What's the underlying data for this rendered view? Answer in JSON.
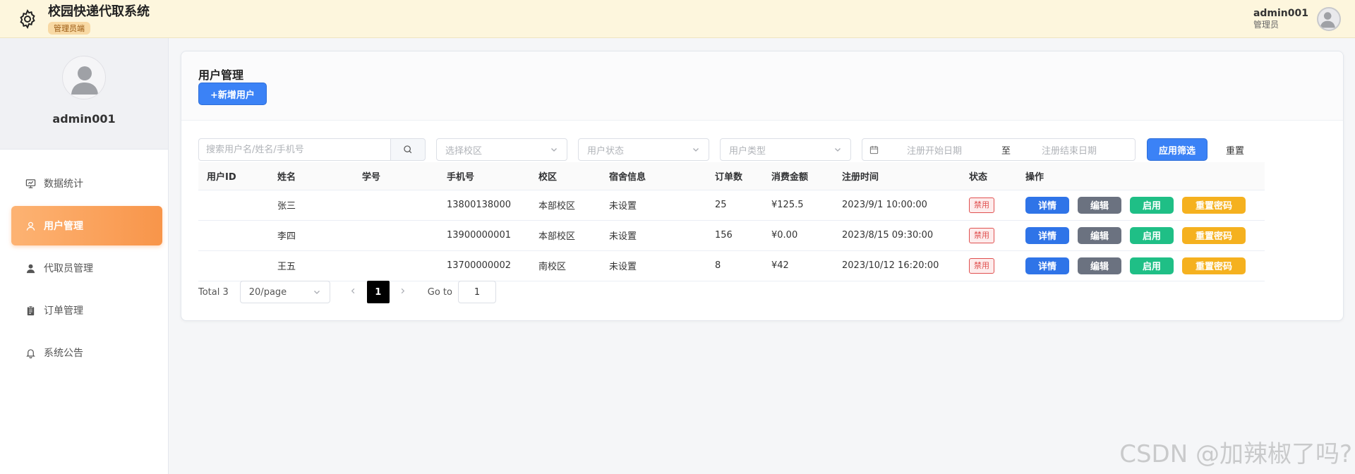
{
  "header": {
    "title": "校园快递代取系统",
    "role_badge": "管理员端",
    "user_name": "admin001",
    "user_role": "管理员"
  },
  "sidebar": {
    "profile_name": "admin001",
    "items": [
      {
        "label": "数据统计",
        "icon": "monitor-icon",
        "active": false
      },
      {
        "label": "用户管理",
        "icon": "user-icon",
        "active": true
      },
      {
        "label": "代取员管理",
        "icon": "person-icon",
        "active": false
      },
      {
        "label": "订单管理",
        "icon": "clipboard-icon",
        "active": false
      },
      {
        "label": "系统公告",
        "icon": "bell-icon",
        "active": false
      }
    ]
  },
  "main": {
    "title": "用户管理",
    "add_button": "+新增用户",
    "filters": {
      "search_placeholder": "搜索用户名/姓名/手机号",
      "campus_placeholder": "选择校区",
      "status_placeholder": "用户状态",
      "type_placeholder": "用户类型",
      "date_start_placeholder": "注册开始日期",
      "date_separator": "至",
      "date_end_placeholder": "注册结束日期",
      "apply_label": "应用筛选",
      "reset_label": "重置"
    },
    "table": {
      "columns": [
        "用户ID",
        "姓名",
        "学号",
        "手机号",
        "校区",
        "宿舍信息",
        "订单数",
        "消费金额",
        "注册时间",
        "状态",
        "操作"
      ],
      "rows": [
        {
          "id": "",
          "name": "张三",
          "student_no": "",
          "phone": "13800138000",
          "campus": "本部校区",
          "dorm": "未设置",
          "orders": "25",
          "amount": "¥125.5",
          "registered": "2023/9/1 10:00:00",
          "status": "禁用"
        },
        {
          "id": "",
          "name": "李四",
          "student_no": "",
          "phone": "13900000001",
          "campus": "本部校区",
          "dorm": "未设置",
          "orders": "156",
          "amount": "¥0.00",
          "registered": "2023/8/15 09:30:00",
          "status": "禁用"
        },
        {
          "id": "",
          "name": "王五",
          "student_no": "",
          "phone": "13700000002",
          "campus": "南校区",
          "dorm": "未设置",
          "orders": "8",
          "amount": "¥42",
          "registered": "2023/10/12 16:20:00",
          "status": "禁用"
        }
      ],
      "actions": {
        "detail": "详情",
        "edit": "编辑",
        "enable": "启用",
        "reset_pwd": "重置密码"
      }
    },
    "pagination": {
      "total_text": "Total 3",
      "page_size": "20/page",
      "current_page": "1",
      "goto_label": "Go to",
      "goto_value": "1"
    }
  },
  "watermark": "CSDN @加辣椒了吗?",
  "colors": {
    "header_bg": "#fdf6dd",
    "accent_blue": "#3b82f6",
    "active_nav": "#f8954a",
    "edit_gray": "#6b7280",
    "enable_green": "#1fbf86",
    "reset_yellow": "#f5b11f",
    "danger_red": "#e0504f"
  }
}
